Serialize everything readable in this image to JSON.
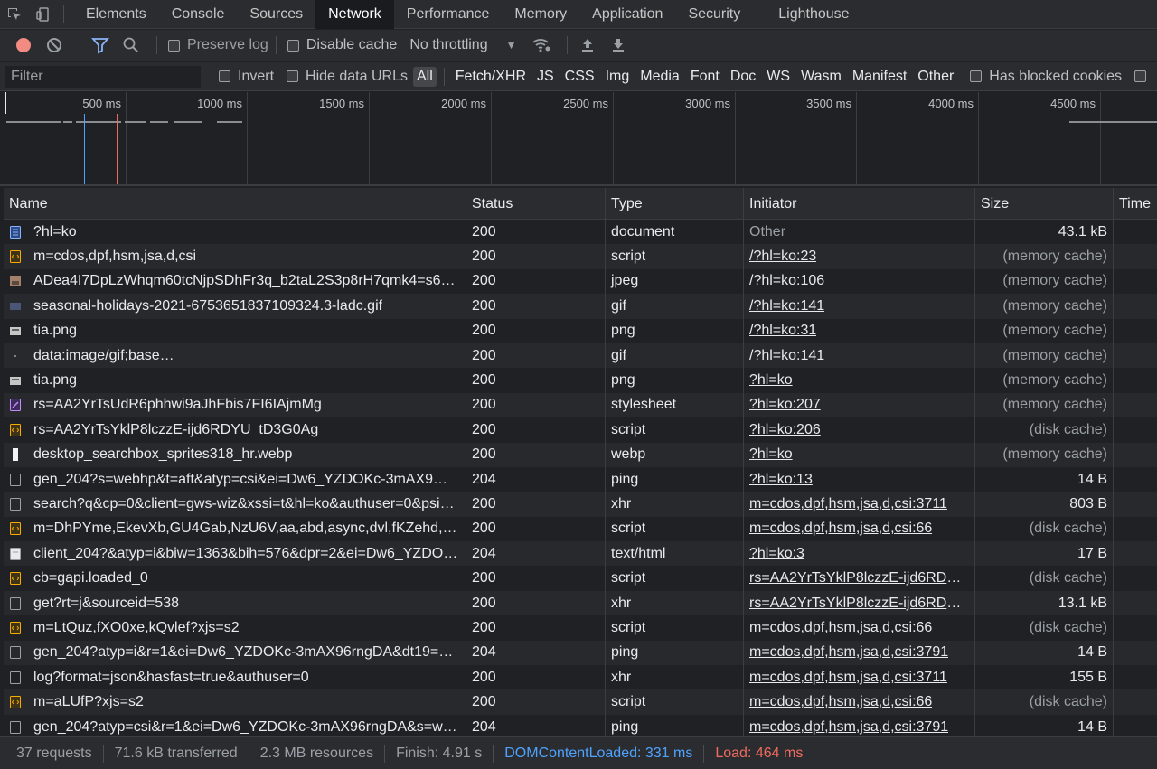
{
  "tabs": [
    {
      "label": "Elements"
    },
    {
      "label": "Console"
    },
    {
      "label": "Sources"
    },
    {
      "label": "Network",
      "active": true
    },
    {
      "label": "Performance"
    },
    {
      "label": "Memory"
    },
    {
      "label": "Application"
    },
    {
      "label": "Security"
    },
    {
      "label": "Lighthouse"
    }
  ],
  "toolbar": {
    "preserve_log": "Preserve log",
    "disable_cache": "Disable cache",
    "throttling": "No throttling"
  },
  "filter": {
    "placeholder": "Filter",
    "invert": "Invert",
    "hide_data_urls": "Hide data URLs",
    "types": [
      "All",
      "Fetch/XHR",
      "JS",
      "CSS",
      "Img",
      "Media",
      "Font",
      "Doc",
      "WS",
      "Wasm",
      "Manifest",
      "Other"
    ],
    "has_blocked_cookies": "Has blocked cookies"
  },
  "overview": {
    "ticks": [
      "500 ms",
      "1000 ms",
      "1500 ms",
      "2000 ms",
      "2500 ms",
      "3000 ms",
      "3500 ms",
      "4000 ms",
      "4500 ms"
    ]
  },
  "columns": {
    "name": "Name",
    "status": "Status",
    "type": "Type",
    "initiator": "Initiator",
    "size": "Size",
    "time": "Time"
  },
  "rows": [
    {
      "icon": "document-icon",
      "name": "?hl=ko",
      "status": "200",
      "type": "document",
      "initiator": "Other",
      "init_link": false,
      "size": "43.1 kB",
      "size_muted": false
    },
    {
      "icon": "script-icon",
      "name": "m=cdos,dpf,hsm,jsa,d,csi",
      "status": "200",
      "type": "script",
      "initiator": "/?hl=ko:23",
      "init_link": true,
      "size": "(memory cache)",
      "size_muted": true
    },
    {
      "icon": "image-icon",
      "name": "ADea4I7DpLzWhqm60tcNjpSDhFr3q_b2taL2S3p8rH7qmk4=s64…",
      "status": "200",
      "type": "jpeg",
      "initiator": "/?hl=ko:106",
      "init_link": true,
      "size": "(memory cache)",
      "size_muted": true
    },
    {
      "icon": "gif-icon",
      "name": "seasonal-holidays-2021-6753651837109324.3-ladc.gif",
      "status": "200",
      "type": "gif",
      "initiator": "/?hl=ko:141",
      "init_link": true,
      "size": "(memory cache)",
      "size_muted": true
    },
    {
      "icon": "png-icon",
      "name": "tia.png",
      "status": "200",
      "type": "png",
      "initiator": "/?hl=ko:31",
      "init_link": true,
      "size": "(memory cache)",
      "size_muted": true
    },
    {
      "icon": "dot-icon",
      "name": "data:image/gif;base…",
      "status": "200",
      "type": "gif",
      "initiator": "/?hl=ko:141",
      "init_link": true,
      "size": "(memory cache)",
      "size_muted": true
    },
    {
      "icon": "png-icon",
      "name": "tia.png",
      "status": "200",
      "type": "png",
      "initiator": "?hl=ko",
      "init_link": true,
      "size": "(memory cache)",
      "size_muted": true
    },
    {
      "icon": "stylesheet-icon",
      "name": "rs=AA2YrTsUdR6phhwi9aJhFbis7FI6IAjmMg",
      "status": "200",
      "type": "stylesheet",
      "initiator": "?hl=ko:207",
      "init_link": true,
      "size": "(memory cache)",
      "size_muted": true
    },
    {
      "icon": "script-icon",
      "name": "rs=AA2YrTsYklP8lczzE-ijd6RDYU_tD3G0Ag",
      "status": "200",
      "type": "script",
      "initiator": "?hl=ko:206",
      "init_link": true,
      "size": "(disk cache)",
      "size_muted": true
    },
    {
      "icon": "webp-icon",
      "name": "desktop_searchbox_sprites318_hr.webp",
      "status": "200",
      "type": "webp",
      "initiator": "?hl=ko",
      "init_link": true,
      "size": "(memory cache)",
      "size_muted": true
    },
    {
      "icon": "blank-icon",
      "name": "gen_204?s=webhp&t=aft&atyp=csi&ei=Dw6_YZDOKc-3mAX9……",
      "status": "204",
      "type": "ping",
      "initiator": "?hl=ko:13",
      "init_link": true,
      "size": "14 B",
      "size_muted": false
    },
    {
      "icon": "blank-icon",
      "name": "search?q&cp=0&client=gws-wiz&xssi=t&hl=ko&authuser=0&psi=…",
      "status": "200",
      "type": "xhr",
      "initiator": "m=cdos,dpf,hsm,jsa,d,csi:3711",
      "init_link": true,
      "size": "803 B",
      "size_muted": false
    },
    {
      "icon": "script-icon",
      "name": "m=DhPYme,EkevXb,GU4Gab,NzU6V,aa,abd,async,dvl,fKZehd,m…",
      "status": "200",
      "type": "script",
      "initiator": "m=cdos,dpf,hsm,jsa,d,csi:66",
      "init_link": true,
      "size": "(disk cache)",
      "size_muted": true
    },
    {
      "icon": "html-icon",
      "name": "client_204?&atyp=i&biw=1363&bih=576&dpr=2&ei=Dw6_YZDOK…",
      "status": "204",
      "type": "text/html",
      "initiator": "?hl=ko:3",
      "init_link": true,
      "size": "17 B",
      "size_muted": false
    },
    {
      "icon": "script-icon",
      "name": "cb=gapi.loaded_0",
      "status": "200",
      "type": "script",
      "initiator": "rs=AA2YrTsYklP8lczzE-ijd6RDY…",
      "init_link": true,
      "size": "(disk cache)",
      "size_muted": true
    },
    {
      "icon": "blank-icon",
      "name": "get?rt=j&sourceid=538",
      "status": "200",
      "type": "xhr",
      "initiator": "rs=AA2YrTsYklP8lczzE-ijd6RDY…",
      "init_link": true,
      "size": "13.1 kB",
      "size_muted": false
    },
    {
      "icon": "script-icon",
      "name": "m=LtQuz,fXO0xe,kQvlef?xjs=s2",
      "status": "200",
      "type": "script",
      "initiator": "m=cdos,dpf,hsm,jsa,d,csi:66",
      "init_link": true,
      "size": "(disk cache)",
      "size_muted": true
    },
    {
      "icon": "blank-icon",
      "name": "gen_204?atyp=i&r=1&ei=Dw6_YZDOKc-3mAX96rngDA&dt19=3…",
      "status": "204",
      "type": "ping",
      "initiator": "m=cdos,dpf,hsm,jsa,d,csi:3791",
      "init_link": true,
      "size": "14 B",
      "size_muted": false
    },
    {
      "icon": "blank-icon",
      "name": "log?format=json&hasfast=true&authuser=0",
      "status": "200",
      "type": "xhr",
      "initiator": "m=cdos,dpf,hsm,jsa,d,csi:3711",
      "init_link": true,
      "size": "155 B",
      "size_muted": false
    },
    {
      "icon": "script-icon",
      "name": "m=aLUfP?xjs=s2",
      "status": "200",
      "type": "script",
      "initiator": "m=cdos,dpf,hsm,jsa,d,csi:66",
      "init_link": true,
      "size": "(disk cache)",
      "size_muted": true
    },
    {
      "icon": "blank-icon",
      "name": "gen_204?atyp=csi&r=1&ei=Dw6_YZDOKc-3mAX96rngDA&s=w…",
      "status": "204",
      "type": "ping",
      "initiator": "m=cdos,dpf,hsm,jsa,d,csi:3791",
      "init_link": true,
      "size": "14 B",
      "size_muted": false
    }
  ],
  "statusbar": {
    "requests": "37 requests",
    "transferred": "71.6 kB transferred",
    "resources": "2.3 MB resources",
    "finish": "Finish: 4.91 s",
    "dom_content_loaded": "DOMContentLoaded: 331 ms",
    "load": "Load: 464 ms"
  },
  "colors": {
    "dom_line": "#4ea3ff",
    "load_line": "#f06b5f",
    "record": "#f28b82"
  }
}
